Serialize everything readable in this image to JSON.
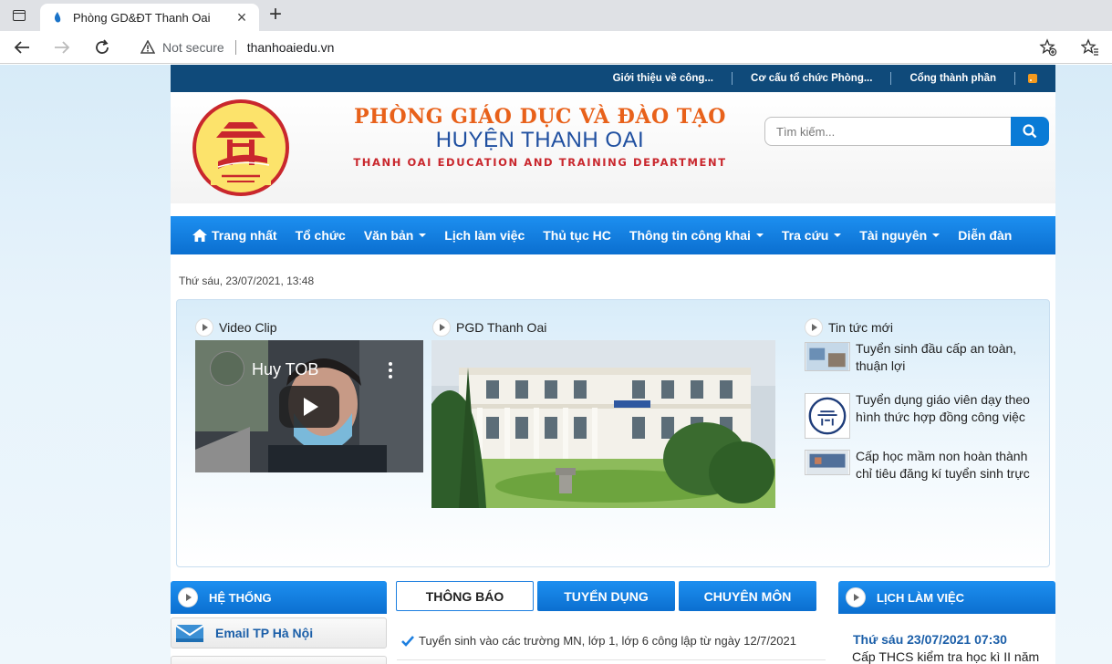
{
  "browser": {
    "tab_title": "Phòng GD&ĐT Thanh Oai",
    "address": {
      "security_label": "Not secure",
      "url": "thanhoaiedu.vn"
    }
  },
  "topbar": {
    "links": [
      "Giới thiệu về công...",
      "Cơ cấu tổ chức Phòng...",
      "Cổng thành phần"
    ]
  },
  "header": {
    "brand_line1": "PHÒNG GIÁO DỤC VÀ ĐÀO TẠO",
    "brand_line2": "HUYỆN THANH OAI",
    "brand_line3": "THANH OAI EDUCATION AND TRAINING DEPARTMENT",
    "search_placeholder": "Tìm kiếm..."
  },
  "nav": {
    "items": [
      {
        "label": "Trang nhất"
      },
      {
        "label": "Tổ chức"
      },
      {
        "label": "Văn bản",
        "dropdown": true
      },
      {
        "label": "Lịch làm việc"
      },
      {
        "label": "Thủ tục HC"
      },
      {
        "label": "Thông tin công khai",
        "dropdown": true
      },
      {
        "label": "Tra cứu",
        "dropdown": true
      },
      {
        "label": "Tài nguyên",
        "dropdown": true
      },
      {
        "label": "Diễn đàn"
      }
    ]
  },
  "date": "Thứ sáu, 23/07/2021, 13:48",
  "featured": {
    "video_title": "Video Clip",
    "video_channel": "Huy TOB",
    "photo_title": "PGD Thanh Oai",
    "news_title": "Tin tức mới",
    "news": [
      "Tuyển sinh đầu cấp an toàn, thuận lợi",
      "Tuyển dụng giáo viên dạy theo hình thức hợp đồng công việc",
      "Cấp học mầm non hoàn thành chỉ tiêu đăng kí tuyển sinh trực"
    ]
  },
  "system": {
    "title": "HỆ THỐNG",
    "links": [
      "Email TP Hà Nội"
    ]
  },
  "tabs": {
    "items": [
      "THÔNG BÁO",
      "TUYỂN DỤNG",
      "CHUYÊN MÔN"
    ],
    "notice": "Tuyển sinh vào các trường MN, lớp 1, lớp 6 công lập từ ngày 12/7/2021"
  },
  "schedule": {
    "title": "LỊCH LÀM VIỆC",
    "date": "Thứ sáu 23/07/2021 07:30",
    "text": "Cấp THCS kiểm tra học kì II năm"
  },
  "colors": {
    "nav_blue": "#0b6fd0",
    "topbar_navy": "#0f4a7a",
    "brand_orange": "#e8611a",
    "brand_blue": "#1f4fa0",
    "brand_red": "#c9272d"
  }
}
